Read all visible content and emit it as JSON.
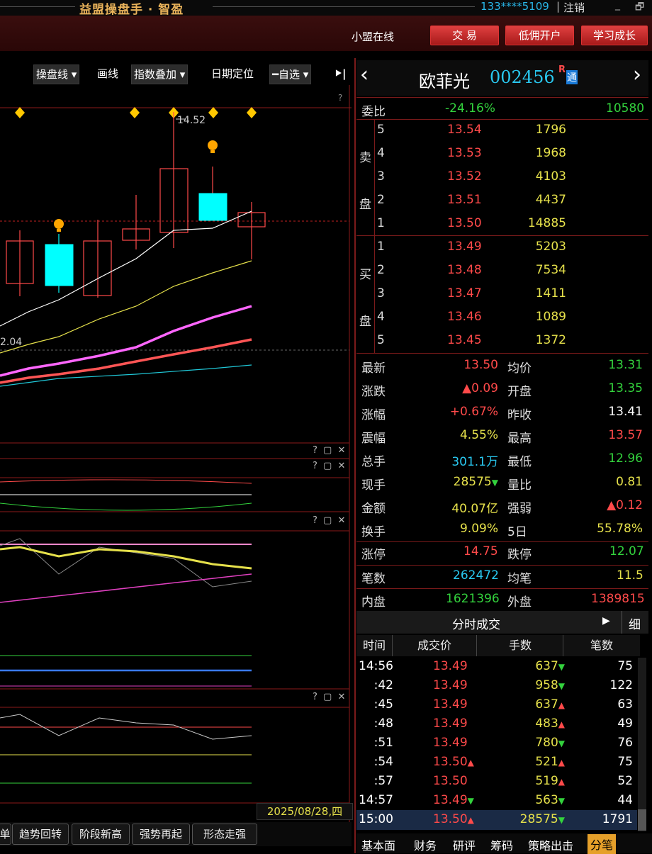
{
  "titlebar": {
    "title": "益盟操盘手 · 智盈",
    "account": "133****5109",
    "sep": "|",
    "logout": "注销",
    "min": "_",
    "max": "🗗"
  },
  "menubar": {
    "online": "小盟在线",
    "btn_trade": "交 易",
    "btn_commission": "低佣开户",
    "btn_learn": "学习成长"
  },
  "toolbar": {
    "items": [
      "操盘线 ▾",
      "画线",
      "指数叠加 ▾",
      "日期定位",
      "━自选 ▾",
      "⯈|"
    ]
  },
  "chart": {
    "high_label": "14.52",
    "low_label": "2.04",
    "panel_ctl": "? ▢ ✕",
    "date": "2025/08/28,四"
  },
  "bottom_tabs": [
    "单",
    "趋势回转",
    "阶段新高",
    "强势再起",
    "形态走强"
  ],
  "quote": {
    "name": "欧菲光",
    "code": "002456",
    "badge_r": "R",
    "badge_tong": "通",
    "prev": "‹",
    "next": "›",
    "weibi_label": "委比",
    "weibi": "-24.16%",
    "weicha": "10580",
    "sell_label": [
      "卖",
      "盘"
    ],
    "buy_label": [
      "买",
      "盘"
    ],
    "sells": [
      [
        "5",
        "13.54",
        "1796"
      ],
      [
        "4",
        "13.53",
        "1968"
      ],
      [
        "3",
        "13.52",
        "4103"
      ],
      [
        "2",
        "13.51",
        "4437"
      ],
      [
        "1",
        "13.50",
        "14885"
      ]
    ],
    "buys": [
      [
        "1",
        "13.49",
        "5203"
      ],
      [
        "2",
        "13.48",
        "7534"
      ],
      [
        "3",
        "13.47",
        "1411"
      ],
      [
        "4",
        "13.46",
        "1089"
      ],
      [
        "5",
        "13.45",
        "1372"
      ]
    ],
    "stats": [
      [
        "最新",
        "13.50",
        "均价",
        "13.31"
      ],
      [
        "涨跌",
        "▲0.09",
        "开盘",
        "13.35"
      ],
      [
        "涨幅",
        "+0.67%",
        "昨收",
        "13.41"
      ],
      [
        "震幅",
        "4.55%",
        "最高",
        "13.57"
      ],
      [
        "总手",
        "301.1万",
        "最低",
        "12.96"
      ],
      [
        "现手",
        "28575▼",
        "量比",
        "0.81"
      ],
      [
        "金额",
        "40.07亿",
        "强弱",
        "▲0.12"
      ],
      [
        "换手",
        "9.09%",
        "5日",
        "55.78%"
      ]
    ],
    "limit": [
      "涨停",
      "14.75",
      "跌停",
      "12.07"
    ],
    "count": [
      "笔数",
      "262472",
      "均笔",
      "11.5"
    ],
    "inout": [
      "内盘",
      "1621396",
      "外盘",
      "1389815"
    ]
  },
  "ticks": {
    "title": "分时成交",
    "play": "▶",
    "detail": "细",
    "cols": [
      "时间",
      "成交价",
      "手数",
      "笔数"
    ],
    "rows": [
      [
        "14:56",
        "13.49",
        "637▼",
        "75"
      ],
      [
        ":42",
        "13.49",
        "958▼",
        "122"
      ],
      [
        ":45",
        "13.49",
        "637▲",
        "63"
      ],
      [
        ":48",
        "13.49",
        "483▲",
        "49"
      ],
      [
        ":51",
        "13.49",
        "780▼",
        "76"
      ],
      [
        ":54",
        "13.50▲",
        "521▲",
        "75"
      ],
      [
        ":57",
        "13.50",
        "519▲",
        "52"
      ],
      [
        "14:57",
        "13.49▼",
        "563▼",
        "44"
      ],
      [
        "15:00",
        "13.50▲",
        "28575▼",
        "1791"
      ]
    ]
  },
  "right_tabs": [
    "基本面",
    "财务",
    "研评",
    "筹码",
    "策略出击",
    "分笔"
  ],
  "colors": {
    "up": "#ff4a4a",
    "down": "#33d23d",
    "accent": "#e6a02a",
    "cyan_candle": "#00ffff"
  }
}
